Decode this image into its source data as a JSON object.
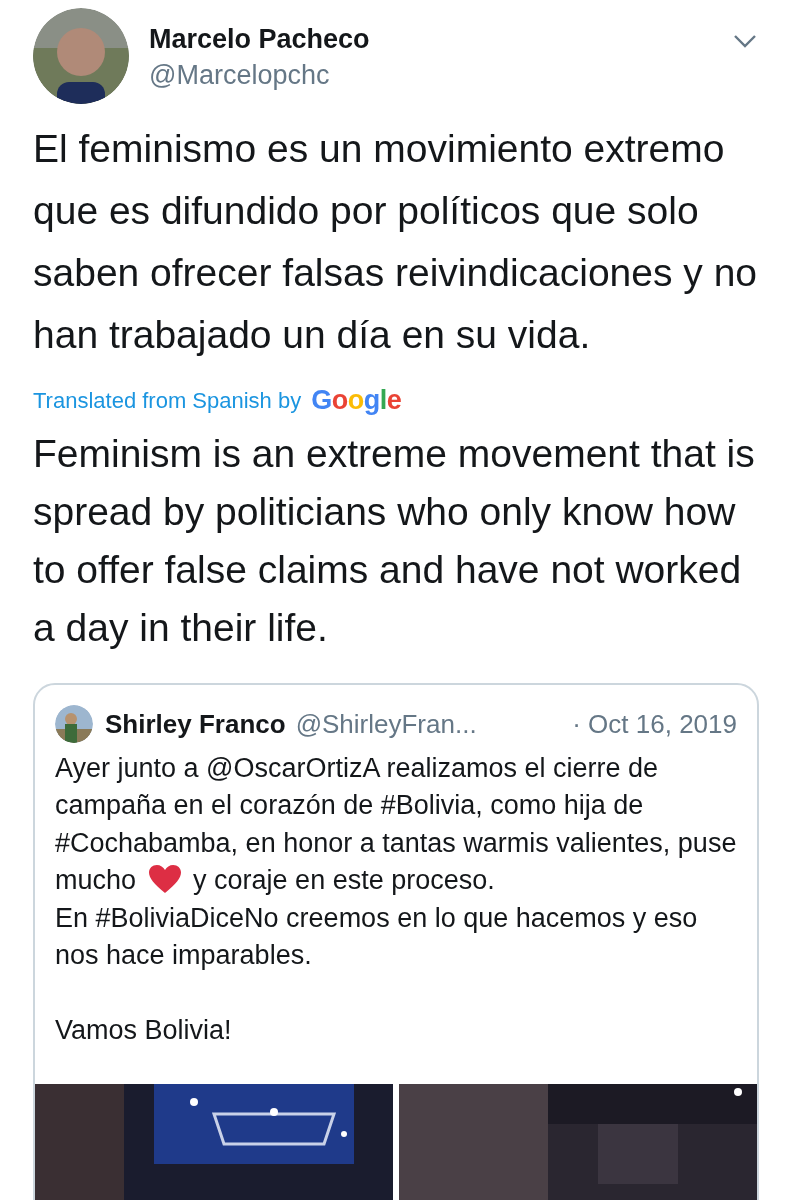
{
  "author": {
    "name": "Marcelo Pacheco",
    "handle": "@Marcelopchc"
  },
  "tweet_text": "El feminismo es un movimiento extremo que es difundido por políticos que solo saben ofrecer falsas reivindicaciones y no han trabajado un día en su vida.",
  "translation": {
    "label": "Translated from Spanish by",
    "provider": "Google",
    "text": "Feminism is an extreme movement that is spread by politicians who only know how to offer false claims and have not worked a day in their life."
  },
  "quoted_tweet": {
    "name": "Shirley Franco",
    "handle": "@ShirleyFran...",
    "date": "· Oct 16, 2019",
    "text_before_heart": "Ayer junto a @OscarOrtizA realizamos el cierre de campaña en el corazón de #Bolivia, como hija de #Cochabamba, en honor a tantas warmis valientes, puse mucho",
    "text_after_heart": "y coraje en este proceso.",
    "paragraphs": [
      "En #BoliviaDiceNo creemos en lo que hacemos y eso nos hace imparables.",
      "Vamos Bolivia!"
    ]
  }
}
